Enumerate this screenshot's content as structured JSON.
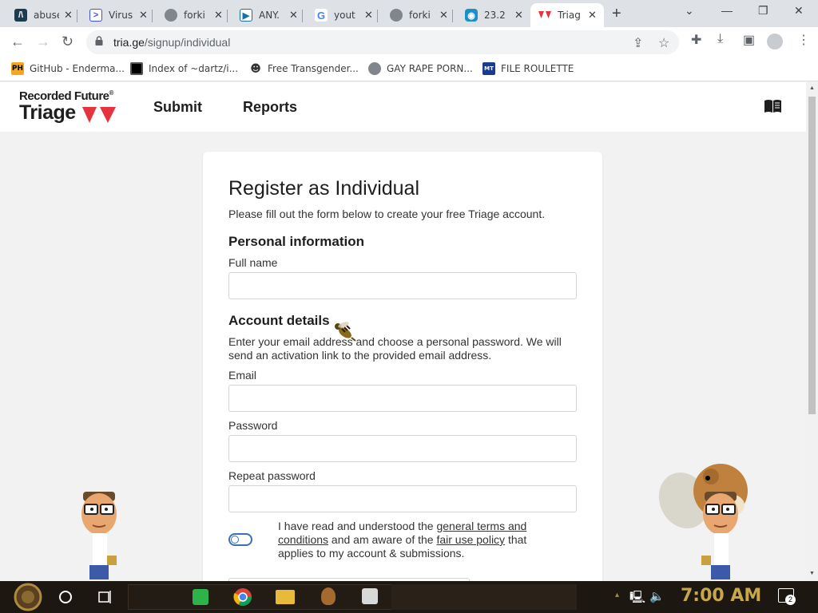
{
  "browser": {
    "tabs": [
      {
        "title": "abuse",
        "icon": "abuse-ch-icon",
        "color": "#1c3b4f",
        "active": false
      },
      {
        "title": "Virus",
        "icon": "virustotal-icon",
        "color": "#394eff",
        "active": false
      },
      {
        "title": "forki",
        "icon": "globe-icon",
        "color": "#5f6368",
        "active": false
      },
      {
        "title": "ANY.",
        "icon": "anyrun-icon",
        "color": "#1b6fa8",
        "active": false
      },
      {
        "title": "yout",
        "icon": "google-icon",
        "color": "#4285f4",
        "active": false
      },
      {
        "title": "forki",
        "icon": "globe-icon",
        "color": "#5f6368",
        "active": false
      },
      {
        "title": "23.2",
        "icon": "location-icon",
        "color": "#1a8fc9",
        "active": false
      },
      {
        "title": "Triag",
        "icon": "triage-icon",
        "color": "#e5343d",
        "active": true
      }
    ],
    "url_host": "tria.ge",
    "url_path": "/signup/individual",
    "bookmarks": [
      {
        "label": "GitHub - Enderma...",
        "icon": "ph-icon",
        "badge": "PH"
      },
      {
        "label": "Index of ~dartz/i...",
        "icon": "qr-icon",
        "badge": ""
      },
      {
        "label": "Free Transgender...",
        "icon": "mask-icon",
        "badge": ""
      },
      {
        "label": "GAY RAPE PORN...",
        "icon": "globe-icon",
        "badge": ""
      },
      {
        "label": "FILE ROULETTE",
        "icon": "file-roulette-icon",
        "badge": ""
      }
    ]
  },
  "site": {
    "brand_top": "Recorded Future",
    "brand_reg": "®",
    "brand_main": "Triage",
    "nav": [
      "Submit",
      "Reports"
    ]
  },
  "form": {
    "title": "Register as Individual",
    "lead": "Please fill out the form below to create your free Triage account.",
    "personal_heading": "Personal information",
    "fullname_label": "Full name",
    "account_heading": "Account details",
    "account_desc": "Enter your email address and choose a personal password. We will send an activation link to the provided email address.",
    "email_label": "Email",
    "password_label": "Password",
    "repeat_label": "Repeat password",
    "terms_pre": "I have read and understood the ",
    "terms_link1": "general terms and conditions",
    "terms_mid": " and am aware of the ",
    "terms_link2": "fair use policy",
    "terms_post": " that applies to my account & submissions."
  },
  "taskbar": {
    "clock": "7:00 AM",
    "notification_count": "2"
  },
  "colors": {
    "brand_red": "#e5343d",
    "toggle_blue": "#3b6fb5",
    "clock_gold": "#c7a74a"
  }
}
